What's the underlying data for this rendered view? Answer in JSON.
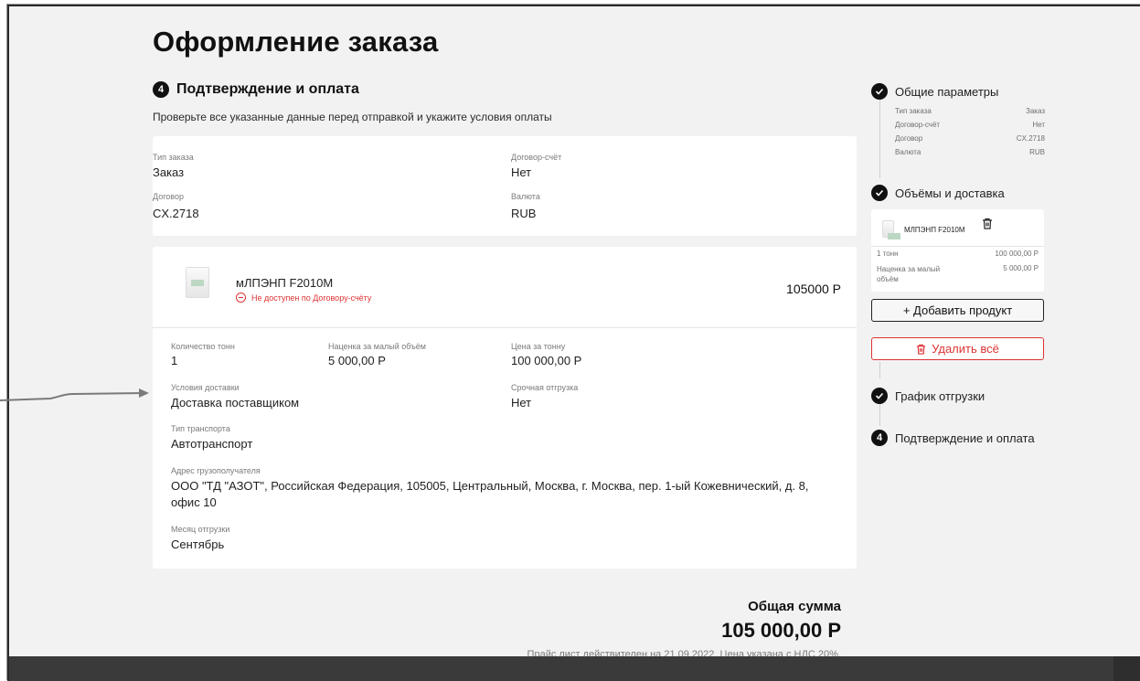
{
  "page": {
    "title": "Оформление заказа",
    "step_number": "4",
    "step_title": "Подтверждение и оплата",
    "hint": "Проверьте все указанные данные перед отправкой и укажите условия оплаты"
  },
  "order_info": {
    "type_label": "Тип заказа",
    "type_value": "Заказ",
    "contract_account_label": "Договор-счёт",
    "contract_account_value": "Нет",
    "contract_label": "Договор",
    "contract_value": "CX.2718",
    "currency_label": "Валюта",
    "currency_value": "RUB"
  },
  "product": {
    "name": "мЛПЭНП F2010M",
    "warning": "Не доступен по Договору-счёту",
    "price": "105000 Р",
    "qty_label": "Количество тонн",
    "qty_value": "1",
    "markup_label": "Наценка за малый объём",
    "markup_value": "5 000,00 Р",
    "price_per_ton_label": "Цена за тонну",
    "price_per_ton_value": "100 000,00 Р",
    "delivery_label": "Условия доставки",
    "delivery_value": "Доставка поставщиком",
    "urgent_label": "Срочная отгрузка",
    "urgent_value": "Нет",
    "transport_label": "Тип транспорта",
    "transport_value": "Автотранспорт",
    "address_label": "Адрес грузополучателя",
    "address_line1": "ООО \"ТД \"АЗОТ\", Российская Федерация, 105005, Центральный, Москва, г. Москва, пер. 1-ый Кожевнический, д. 8,",
    "address_line2": "офис 10",
    "month_label": "Месяц отгрузки",
    "month_value": "Сентябрь"
  },
  "total": {
    "label": "Общая сумма",
    "value": "105 000,00 Р",
    "note": "Прайс лист действителен на 21.09.2022. Цена указана с НДС 20%."
  },
  "sidebar": {
    "step1": {
      "label": "Общие параметры",
      "rows": [
        {
          "k": "Тип заказа",
          "v": "Заказ"
        },
        {
          "k": "Договор-счёт",
          "v": "Нет"
        },
        {
          "k": "Договор",
          "v": "CX.2718"
        },
        {
          "k": "Валюта",
          "v": "RUB"
        }
      ]
    },
    "step2": {
      "label": "Объёмы и доставка",
      "product_name": "МЛПЭНП F2010M",
      "qty": "1 тонн",
      "qty_price": "100 000,00 Р",
      "markup_label": "Наценка за малый объём",
      "markup_price": "5 000,00 Р"
    },
    "add_product": "+ Добавить продукт",
    "delete_all": "Удалить всё",
    "step3": {
      "label": "График отгрузки"
    },
    "step4": {
      "number": "4",
      "label": "Подтверждение и оплата"
    }
  }
}
